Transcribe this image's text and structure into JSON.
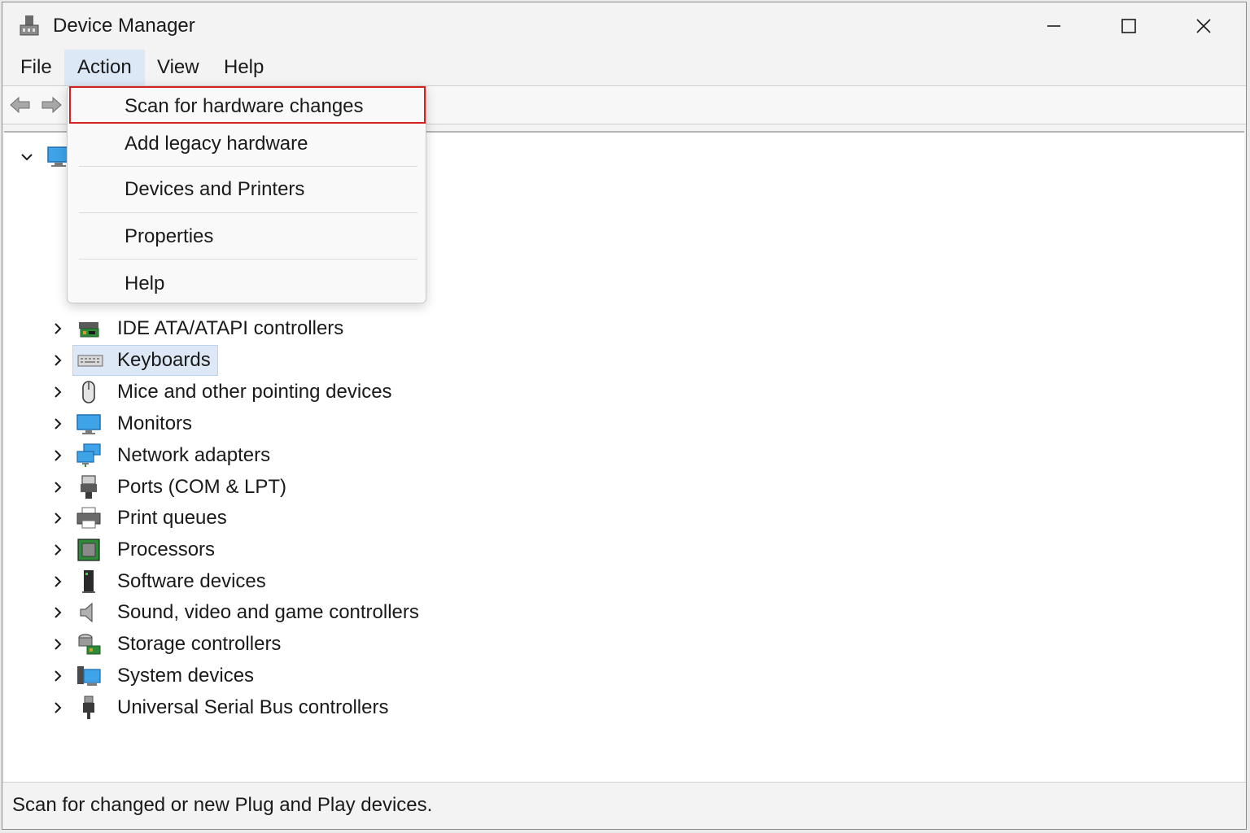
{
  "window": {
    "title": "Device Manager"
  },
  "title_buttons": [
    "minimize-icon",
    "maximize-icon",
    "close-icon"
  ],
  "menu": {
    "file": "File",
    "action": "Action",
    "view": "View",
    "help": "Help"
  },
  "toolbar": {
    "icons": [
      "back-arrow-icon",
      "forward-arrow-icon"
    ]
  },
  "action_menu": {
    "items": [
      "Scan  for  hardware  changes",
      "Add legacy hardware",
      "Devices and Printers",
      "Properties",
      "Help"
    ],
    "highlight_color": "#d32020"
  },
  "tree": {
    "categories": [
      {
        "label": "IDE ATA/ATAPI controllers",
        "icon": "ide-controller-icon"
      },
      {
        "label": "Keyboards",
        "icon": "keyboard-icon",
        "selected": true
      },
      {
        "label": "Mice and other pointing devices",
        "icon": "mouse-icon"
      },
      {
        "label": "Monitors",
        "icon": "monitor-icon"
      },
      {
        "label": "Network adapters",
        "icon": "network-adapter-icon"
      },
      {
        "label": "Ports (COM & LPT)",
        "icon": "port-icon"
      },
      {
        "label": "Print queues",
        "icon": "printer-icon"
      },
      {
        "label": "Processors",
        "icon": "processor-icon"
      },
      {
        "label": "Software devices",
        "icon": "software-device-icon"
      },
      {
        "label": "Sound, video and game controllers",
        "icon": "speaker-icon"
      },
      {
        "label": "Storage controllers",
        "icon": "storage-controller-icon"
      },
      {
        "label": "System devices",
        "icon": "system-device-icon"
      },
      {
        "label": "Universal Serial Bus controllers",
        "icon": "usb-icon"
      }
    ]
  },
  "status": {
    "text": "Scan for changed or new Plug and Play devices."
  },
  "colors": {
    "selection": "#dce8f5",
    "menu_active": "#dce8f5"
  }
}
